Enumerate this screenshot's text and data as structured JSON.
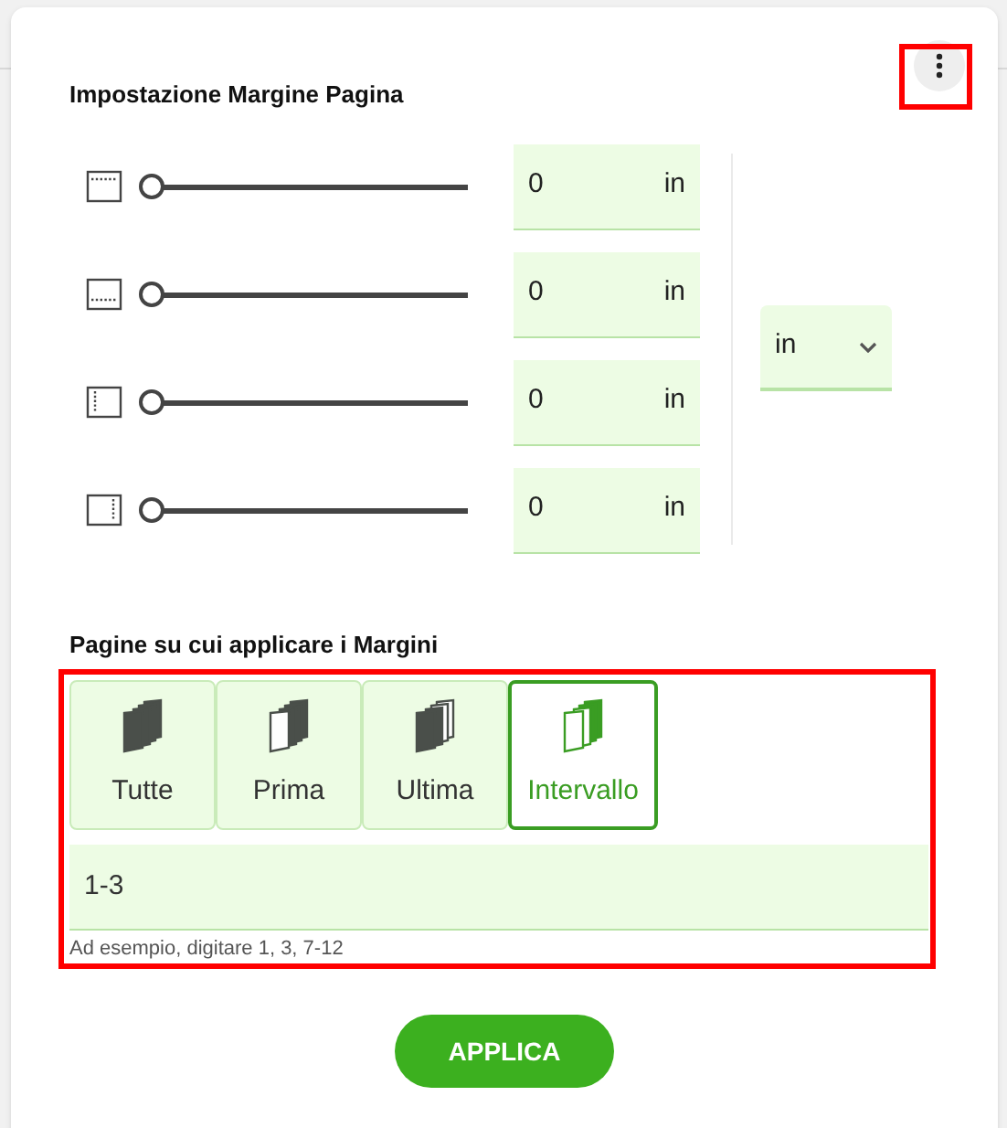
{
  "title": "Impostazione Margine Pagina",
  "margins": [
    {
      "kind": "top",
      "level": 0,
      "value": "0",
      "unit": "in"
    },
    {
      "kind": "bottom",
      "level": 0,
      "value": "0",
      "unit": "in"
    },
    {
      "kind": "left",
      "level": 0,
      "value": "0",
      "unit": "in"
    },
    {
      "kind": "right",
      "level": 0,
      "value": "0",
      "unit": "in"
    }
  ],
  "unit_select": {
    "value": "in"
  },
  "pages_title": "Pagine su cui applicare i Margini",
  "page_options": [
    {
      "label": "Tutte",
      "kind": "all",
      "selected": false
    },
    {
      "label": "Prima",
      "kind": "first",
      "selected": false
    },
    {
      "label": "Ultima",
      "kind": "last",
      "selected": false
    },
    {
      "label": "Intervallo",
      "kind": "range",
      "selected": true
    }
  ],
  "range_field": {
    "value": "1-3",
    "hint": "Ad esempio, digitare 1, 3, 7-12"
  },
  "apply_button": "APPLICA"
}
